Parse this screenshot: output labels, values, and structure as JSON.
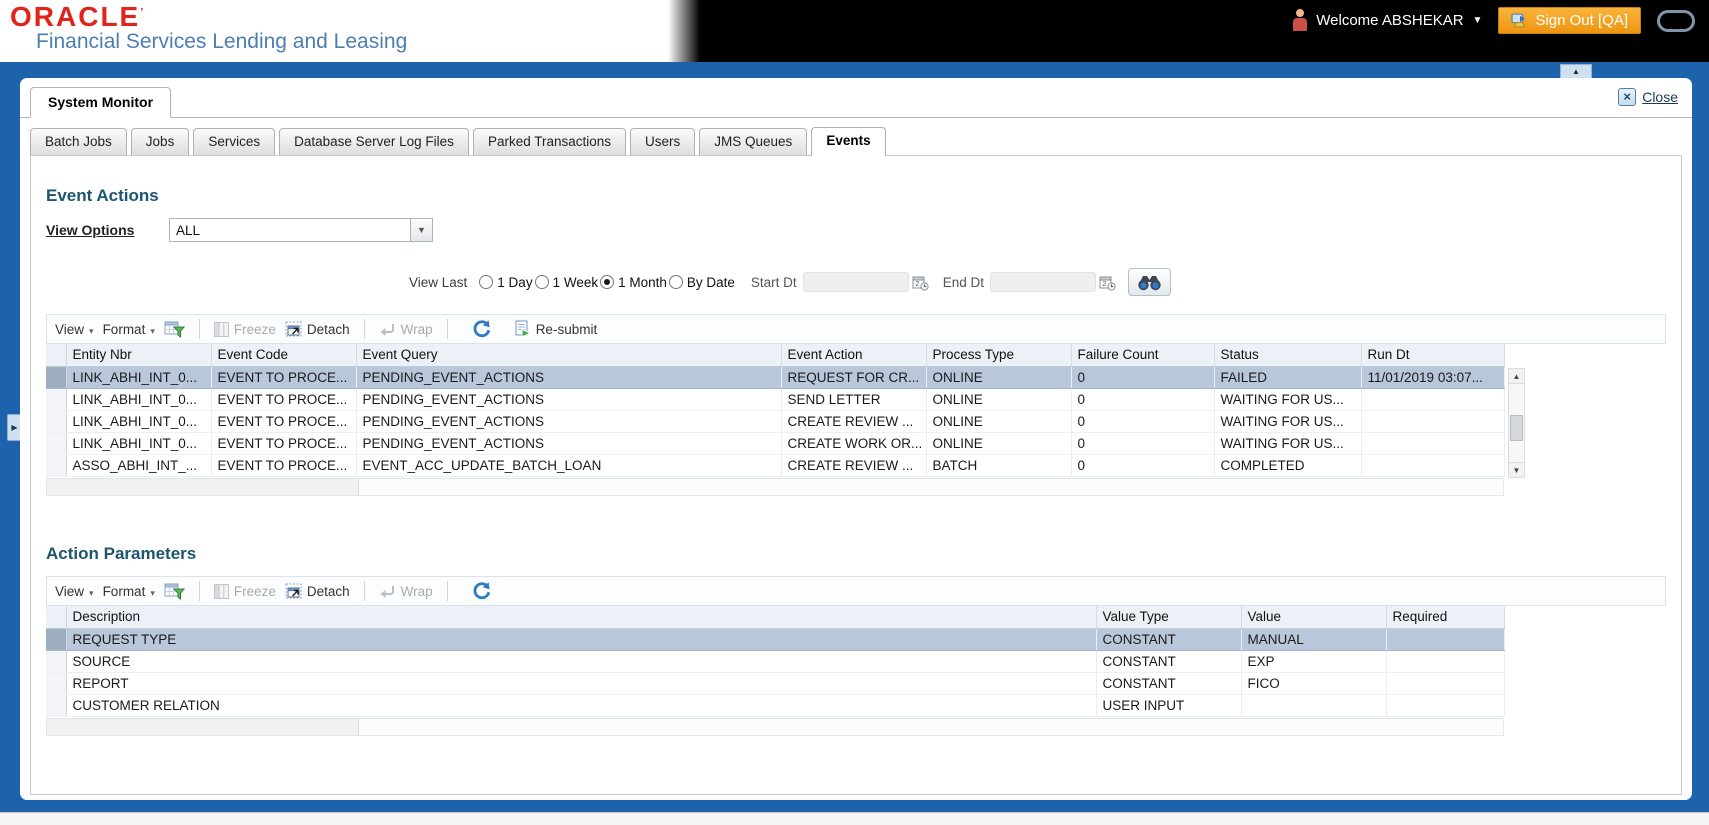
{
  "header": {
    "brand": "ORACLE",
    "subtitle": "Financial Services Lending and Leasing",
    "welcome": "Welcome ABSHEKAR",
    "sign_out": "Sign Out [QA]"
  },
  "window": {
    "main_tab": "System Monitor",
    "close_label": "Close"
  },
  "tabs": [
    {
      "label": "Batch Jobs"
    },
    {
      "label": "Jobs"
    },
    {
      "label": "Services"
    },
    {
      "label": "Database Server Log Files"
    },
    {
      "label": "Parked Transactions"
    },
    {
      "label": "Users"
    },
    {
      "label": "JMS Queues"
    },
    {
      "label": "Events"
    }
  ],
  "event_actions": {
    "title": "Event Actions",
    "view_options_label": "View Options",
    "view_options_value": "ALL",
    "view_last_label": "View Last",
    "radios": [
      {
        "label": "1 Day",
        "selected": false
      },
      {
        "label": "1 Week",
        "selected": false
      },
      {
        "label": "1 Month",
        "selected": true
      },
      {
        "label": "By Date",
        "selected": false
      }
    ],
    "start_dt_label": "Start Dt",
    "start_dt_value": "",
    "end_dt_label": "End Dt",
    "end_dt_value": "",
    "toolbar": {
      "view": "View",
      "format": "Format",
      "freeze": "Freeze",
      "detach": "Detach",
      "wrap": "Wrap",
      "resubmit": "Re-submit"
    },
    "columns": [
      "Entity Nbr",
      "Event Code",
      "Event Query",
      "Event Action",
      "Process Type",
      "Failure Count",
      "Status",
      "Run Dt"
    ],
    "rows": [
      [
        "LINK_ABHI_INT_0...",
        "EVENT TO PROCE...",
        "PENDING_EVENT_ACTIONS",
        "REQUEST FOR CR...",
        "ONLINE",
        "0",
        "FAILED",
        "11/01/2019 03:07..."
      ],
      [
        "LINK_ABHI_INT_0...",
        "EVENT TO PROCE...",
        "PENDING_EVENT_ACTIONS",
        "SEND LETTER",
        "ONLINE",
        "0",
        "WAITING FOR US...",
        ""
      ],
      [
        "LINK_ABHI_INT_0...",
        "EVENT TO PROCE...",
        "PENDING_EVENT_ACTIONS",
        "CREATE REVIEW ...",
        "ONLINE",
        "0",
        "WAITING FOR US...",
        ""
      ],
      [
        "LINK_ABHI_INT_0...",
        "EVENT TO PROCE...",
        "PENDING_EVENT_ACTIONS",
        "CREATE WORK OR...",
        "ONLINE",
        "0",
        "WAITING FOR US...",
        ""
      ],
      [
        "ASSO_ABHI_INT_...",
        "EVENT TO PROCE...",
        "EVENT_ACC_UPDATE_BATCH_LOAN",
        "CREATE REVIEW ...",
        "BATCH",
        "0",
        "COMPLETED",
        ""
      ]
    ]
  },
  "action_parameters": {
    "title": "Action Parameters",
    "toolbar": {
      "view": "View",
      "format": "Format",
      "freeze": "Freeze",
      "detach": "Detach",
      "wrap": "Wrap"
    },
    "columns": [
      "Description",
      "Value Type",
      "Value",
      "Required"
    ],
    "rows": [
      [
        "REQUEST TYPE",
        "CONSTANT",
        "MANUAL",
        ""
      ],
      [
        "SOURCE",
        "CONSTANT",
        "EXP",
        ""
      ],
      [
        "REPORT",
        "CONSTANT",
        "FICO",
        ""
      ],
      [
        "CUSTOMER RELATION",
        "USER INPUT",
        "",
        ""
      ]
    ]
  },
  "colors": {
    "frame_blue": "#1d63ab",
    "heading_blue": "#1c5570",
    "selected_row": "#b8c7da",
    "signout_orange": "#ee9512",
    "oracle_red": "#e2231a",
    "subtitle_blue": "#4d7eb3"
  }
}
